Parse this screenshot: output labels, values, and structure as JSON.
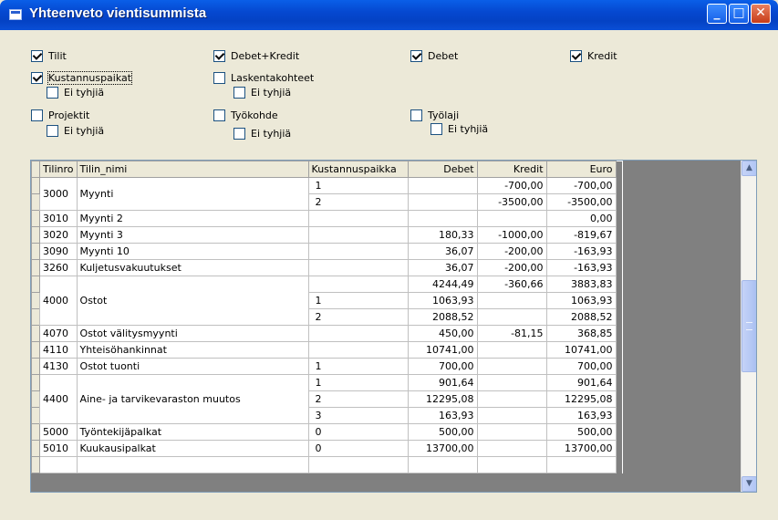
{
  "window": {
    "title": "Yhteenveto vientisummista",
    "minimize_glyph": "_",
    "maximize_glyph": "□",
    "close_glyph": "✕"
  },
  "options": {
    "tilit": {
      "label": "Tilit",
      "checked": true
    },
    "debet_kredit": {
      "label": "Debet+Kredit",
      "checked": true
    },
    "debet": {
      "label": "Debet",
      "checked": true
    },
    "kredit": {
      "label": "Kredit",
      "checked": true
    },
    "kustannuspaikat": {
      "label": "Kustannuspaikat",
      "checked": true
    },
    "kustannuspaikat_ei_tyhjia": {
      "label": "Ei tyhjiä",
      "checked": false
    },
    "laskentakohteet": {
      "label": "Laskentakohteet",
      "checked": false
    },
    "laskentakohteet_ei_tyhjia": {
      "label": "Ei tyhjiä",
      "checked": false
    },
    "projektit": {
      "label": "Projektit",
      "checked": false
    },
    "projektit_ei_tyhjia": {
      "label": "Ei tyhjiä",
      "checked": false
    },
    "tyokohde": {
      "label": "Työkohde",
      "checked": false
    },
    "tyokohde_ei_tyhjia": {
      "label": "Ei tyhjiä",
      "checked": false
    },
    "tyolaji": {
      "label": "Työlaji",
      "checked": false
    },
    "tyolaji_ei_tyhjia": {
      "label": "Ei tyhjiä",
      "checked": false
    }
  },
  "grid": {
    "columns": [
      "Tilinro",
      "Tilin_nimi",
      "Kustannuspaikka",
      "Debet",
      "Kredit",
      "Euro"
    ],
    "groups": [
      {
        "tilinro": "3000",
        "nimi": "Myynti",
        "rows": [
          [
            "1",
            "",
            "-700,00",
            "-700,00"
          ],
          [
            "2",
            "",
            "-3500,00",
            "-3500,00"
          ]
        ]
      },
      {
        "tilinro": "3010",
        "nimi": "Myynti 2",
        "rows": [
          [
            "",
            "",
            "",
            "0,00"
          ]
        ]
      },
      {
        "tilinro": "3020",
        "nimi": "Myynti 3",
        "rows": [
          [
            "",
            "180,33",
            "-1000,00",
            "-819,67"
          ]
        ]
      },
      {
        "tilinro": "3090",
        "nimi": "Myynti 10",
        "rows": [
          [
            "",
            "36,07",
            "-200,00",
            "-163,93"
          ]
        ]
      },
      {
        "tilinro": "3260",
        "nimi": "Kuljetusvakuutukset",
        "rows": [
          [
            "",
            "36,07",
            "-200,00",
            "-163,93"
          ]
        ]
      },
      {
        "tilinro": "4000",
        "nimi": "Ostot",
        "rows": [
          [
            "",
            "4244,49",
            "-360,66",
            "3883,83"
          ],
          [
            "1",
            "1063,93",
            "",
            "1063,93"
          ],
          [
            "2",
            "2088,52",
            "",
            "2088,52"
          ]
        ]
      },
      {
        "tilinro": "4070",
        "nimi": "Ostot välitysmyynti",
        "rows": [
          [
            "",
            "450,00",
            "-81,15",
            "368,85"
          ]
        ]
      },
      {
        "tilinro": "4110",
        "nimi": "Yhteisöhankinnat",
        "rows": [
          [
            "",
            "10741,00",
            "",
            "10741,00"
          ]
        ]
      },
      {
        "tilinro": "4130",
        "nimi": "Ostot tuonti",
        "rows": [
          [
            "1",
            "700,00",
            "",
            "700,00"
          ]
        ]
      },
      {
        "tilinro": "4400",
        "nimi": "Aine- ja tarvikevaraston muutos",
        "rows": [
          [
            "1",
            "901,64",
            "",
            "901,64"
          ],
          [
            "2",
            "12295,08",
            "",
            "12295,08"
          ],
          [
            "3",
            "163,93",
            "",
            "163,93"
          ]
        ]
      },
      {
        "tilinro": "5000",
        "nimi": "Työntekijäpalkat",
        "rows": [
          [
            "0",
            "500,00",
            "",
            "500,00"
          ]
        ]
      },
      {
        "tilinro": "5010",
        "nimi": "Kuukausipalkat",
        "rows": [
          [
            "0",
            "13700,00",
            "",
            "13700,00"
          ]
        ]
      },
      {
        "tilinro": "",
        "nimi": "",
        "rows": [
          [
            "",
            "",
            "",
            ""
          ]
        ]
      }
    ]
  },
  "scrollbar": {
    "up_icon": "▲",
    "down_icon": "▼",
    "grip_icon": "≡"
  }
}
